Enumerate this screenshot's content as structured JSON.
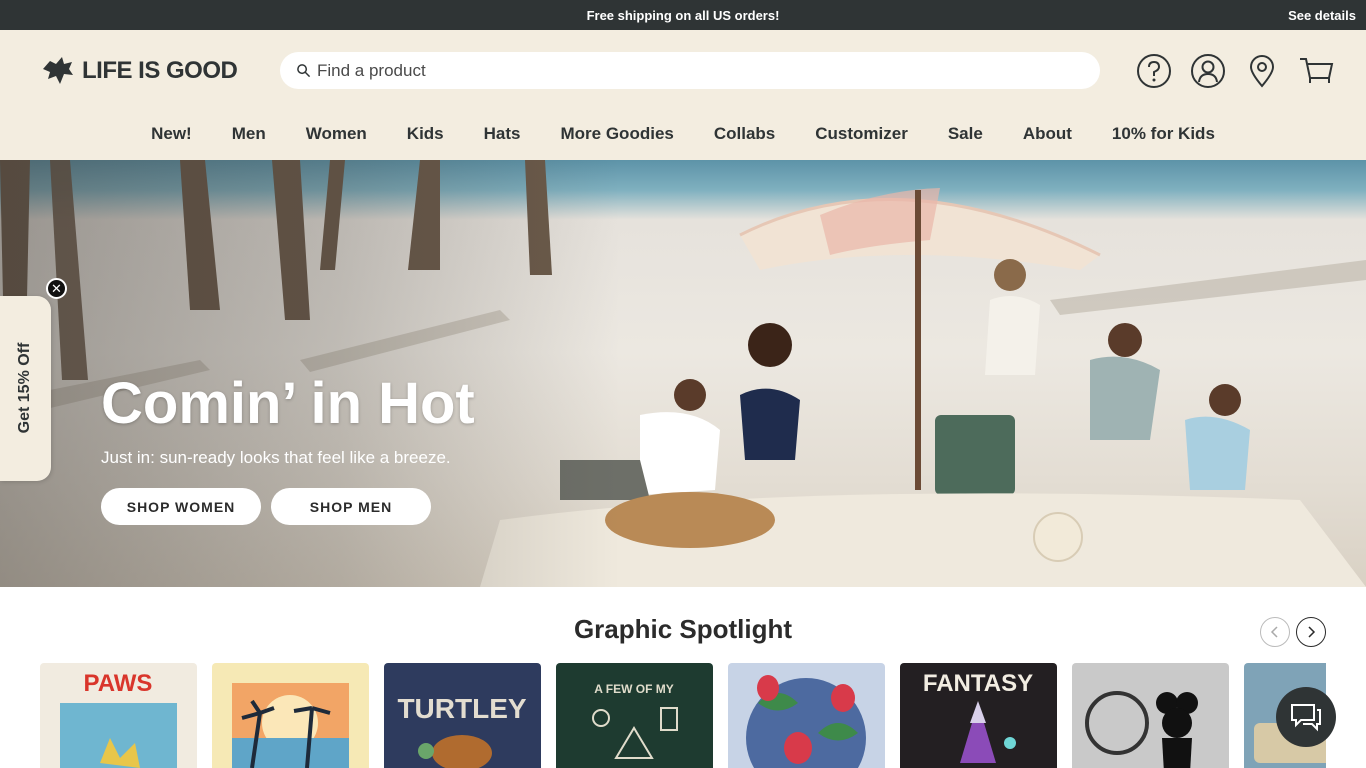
{
  "announcement": {
    "message": "Free shipping on all US orders!",
    "details_link": "See details"
  },
  "header": {
    "logo_text": "LIFE IS GOOD",
    "search_placeholder": "Find a product",
    "icons": [
      "help-icon",
      "account-icon",
      "store-locator-icon",
      "cart-icon"
    ]
  },
  "nav": [
    "New!",
    "Men",
    "Women",
    "Kids",
    "Hats",
    "More Goodies",
    "Collabs",
    "Customizer",
    "Sale",
    "About",
    "10% for Kids"
  ],
  "hero": {
    "title": "Comin’ in Hot",
    "subtitle": "Just in: sun-ready looks that feel like a breeze.",
    "buttons": [
      "SHOP WOMEN",
      "SHOP MEN"
    ]
  },
  "side_tab": {
    "label": "Get 15% Off",
    "close": "✕"
  },
  "spotlight": {
    "title": "Graphic Spotlight",
    "cards": [
      {
        "text": "PAWS",
        "bg": "#f1ebe0"
      },
      {
        "text": "",
        "bg": "#f6e9b5"
      },
      {
        "text": "TURTLEY",
        "bg": "#2e3b5e"
      },
      {
        "text": "A FEW OF MY",
        "bg": "#1e3b30"
      },
      {
        "text": "",
        "bg": "#c7d3e6"
      },
      {
        "text": "FANTASY",
        "bg": "#231f22"
      },
      {
        "text": "",
        "bg": "#c9c9c9"
      },
      {
        "text": "",
        "bg": "#7fa3b7"
      }
    ]
  },
  "colors": {
    "header_bg": "#f3ede0",
    "announce_bg": "#2f3435",
    "text_dark": "#2f3435"
  }
}
